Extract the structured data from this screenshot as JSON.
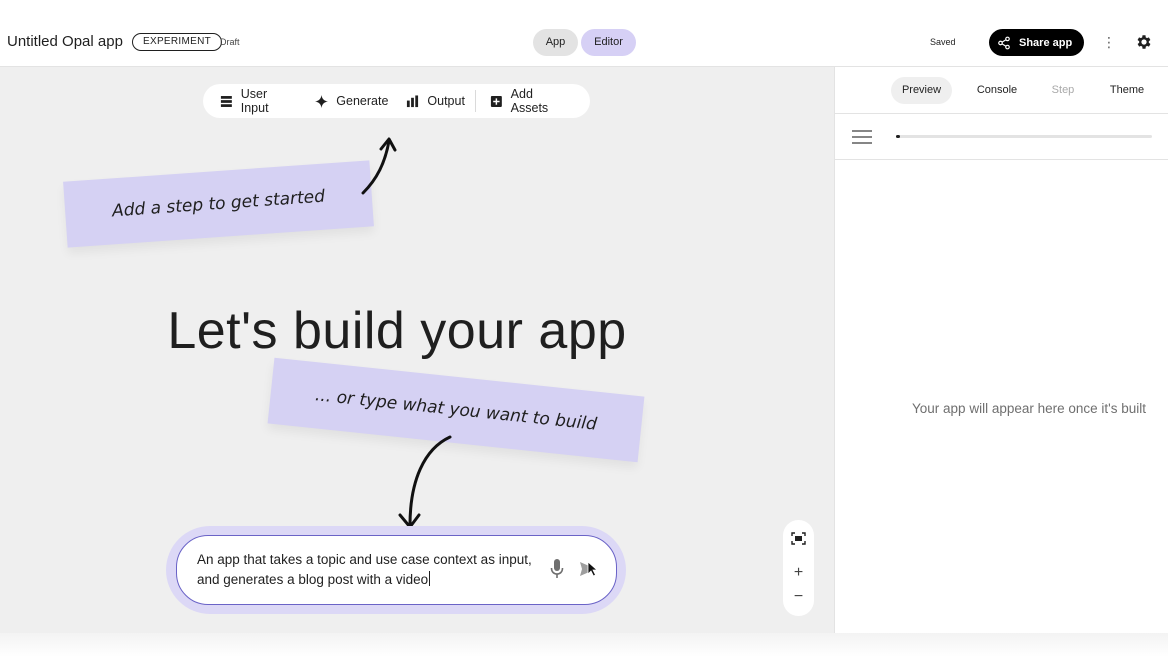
{
  "header": {
    "app_title": "Untitled Opal app",
    "badge": "EXPERIMENT",
    "status": "Draft",
    "mode_tabs": [
      {
        "label": "App",
        "active": false
      },
      {
        "label": "Editor",
        "active": true
      }
    ],
    "save_status": "Saved",
    "share_label": "Share app",
    "more_icon": "more-vert-icon",
    "settings_icon": "gear-icon"
  },
  "toolbar": {
    "items": [
      {
        "label": "User Input",
        "icon": "user-input-icon"
      },
      {
        "label": "Generate",
        "icon": "sparkle-icon"
      },
      {
        "label": "Output",
        "icon": "bar-chart-icon"
      },
      {
        "label": "Add Assets",
        "icon": "add-box-icon"
      }
    ]
  },
  "canvas": {
    "note_step": "Add a step to get started",
    "heading": "Let's build your app",
    "note_type": "... or type what you want to build",
    "prompt_value": "An app that takes a topic and use case context as input, and generates a blog post with a video",
    "mic_icon": "mic-icon",
    "send_icon": "send-icon",
    "zoom": {
      "fit_icon": "fit-screen-icon",
      "zoom_in": "+",
      "zoom_out": "−"
    }
  },
  "preview_panel": {
    "tabs": [
      {
        "label": "Preview",
        "active": true,
        "disabled": false
      },
      {
        "label": "Console",
        "active": false,
        "disabled": false
      },
      {
        "label": "Step",
        "active": false,
        "disabled": true
      },
      {
        "label": "Theme",
        "active": false,
        "disabled": false
      }
    ],
    "progress": 0.01,
    "placeholder": "Your app will appear here once it's built"
  },
  "colors": {
    "accent": "#d6d0f5",
    "sticky_note": "#d5d1f3",
    "canvas_bg": "#efefef",
    "prompt_border": "#6a63c7"
  }
}
